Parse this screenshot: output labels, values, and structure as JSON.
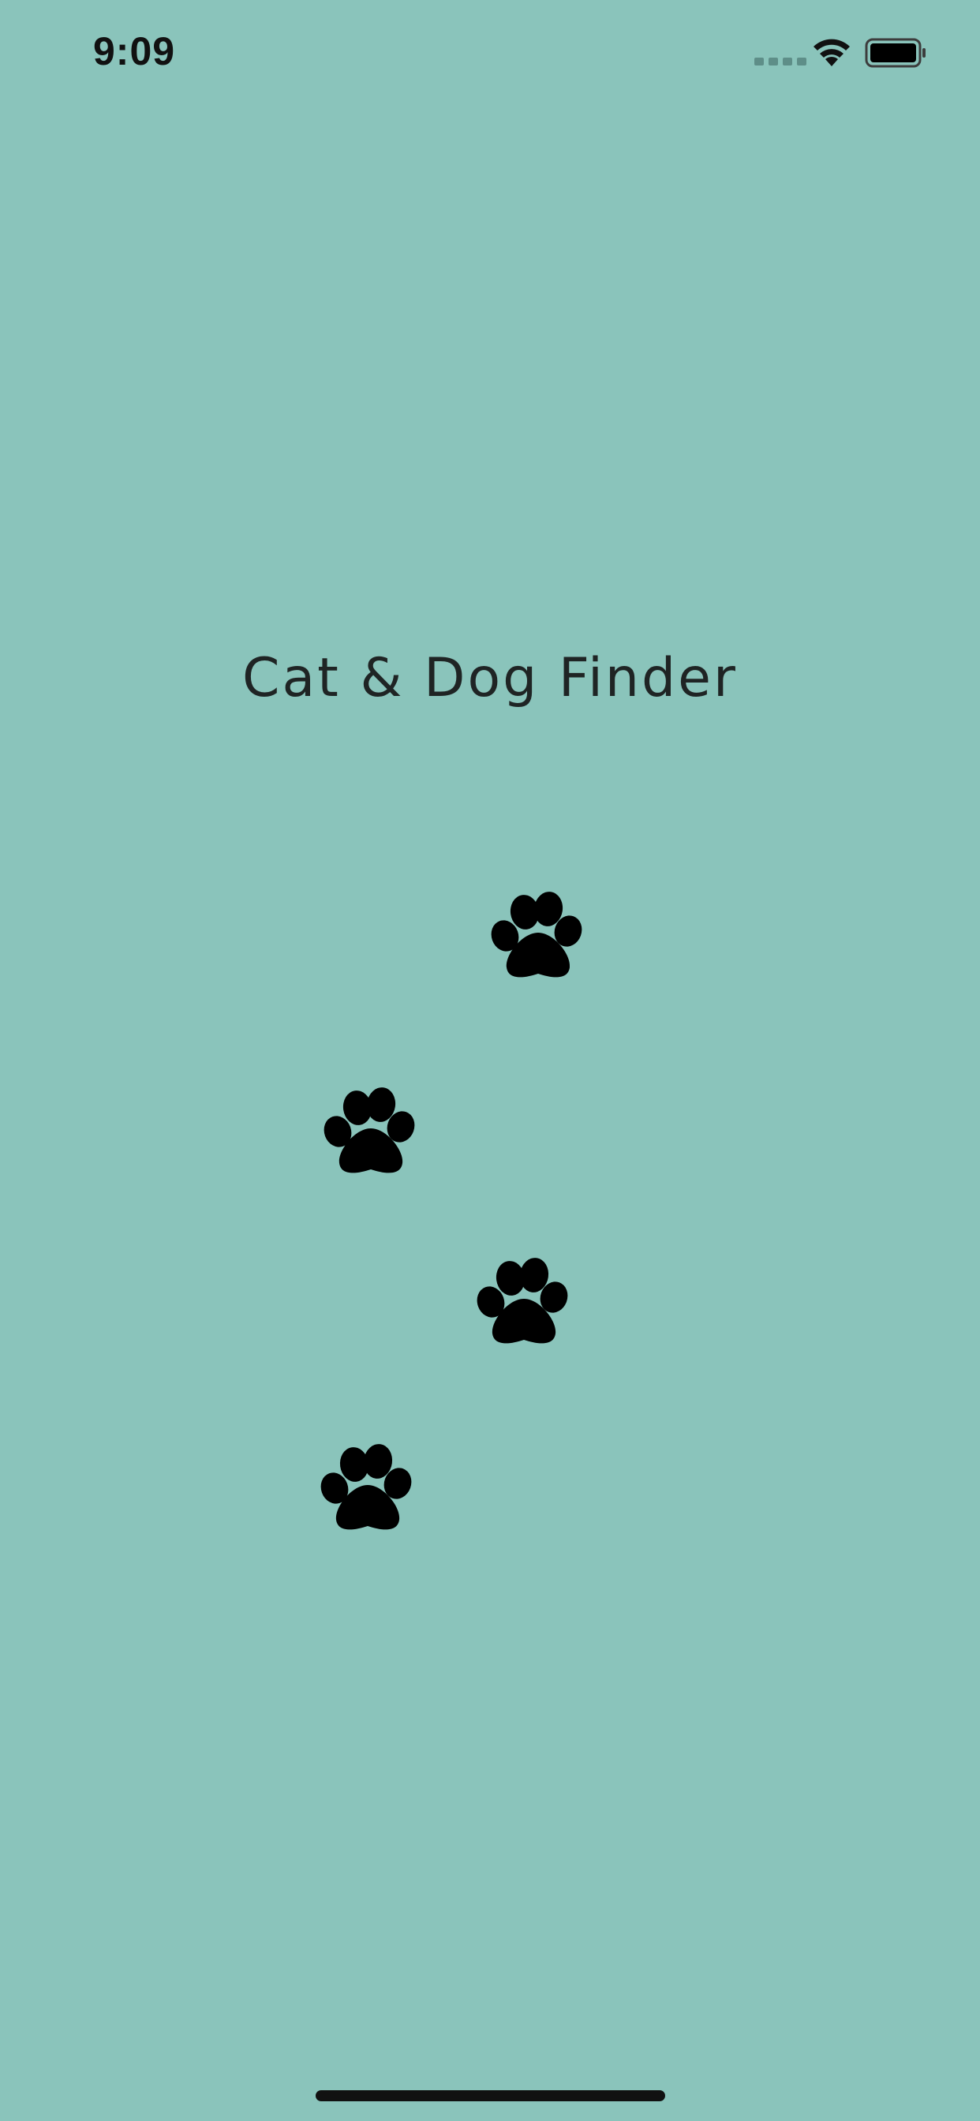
{
  "status_bar": {
    "time": "9:09",
    "icons": [
      "signal-dots-icon",
      "wifi-icon",
      "battery-icon"
    ]
  },
  "app": {
    "title": "Cat & Dog Finder"
  },
  "paw_prints": {
    "icon": "paw-icon",
    "count": 4
  },
  "colors": {
    "background": "#8AC4BB",
    "foreground": "#000000",
    "title_text": "#1F2424"
  }
}
